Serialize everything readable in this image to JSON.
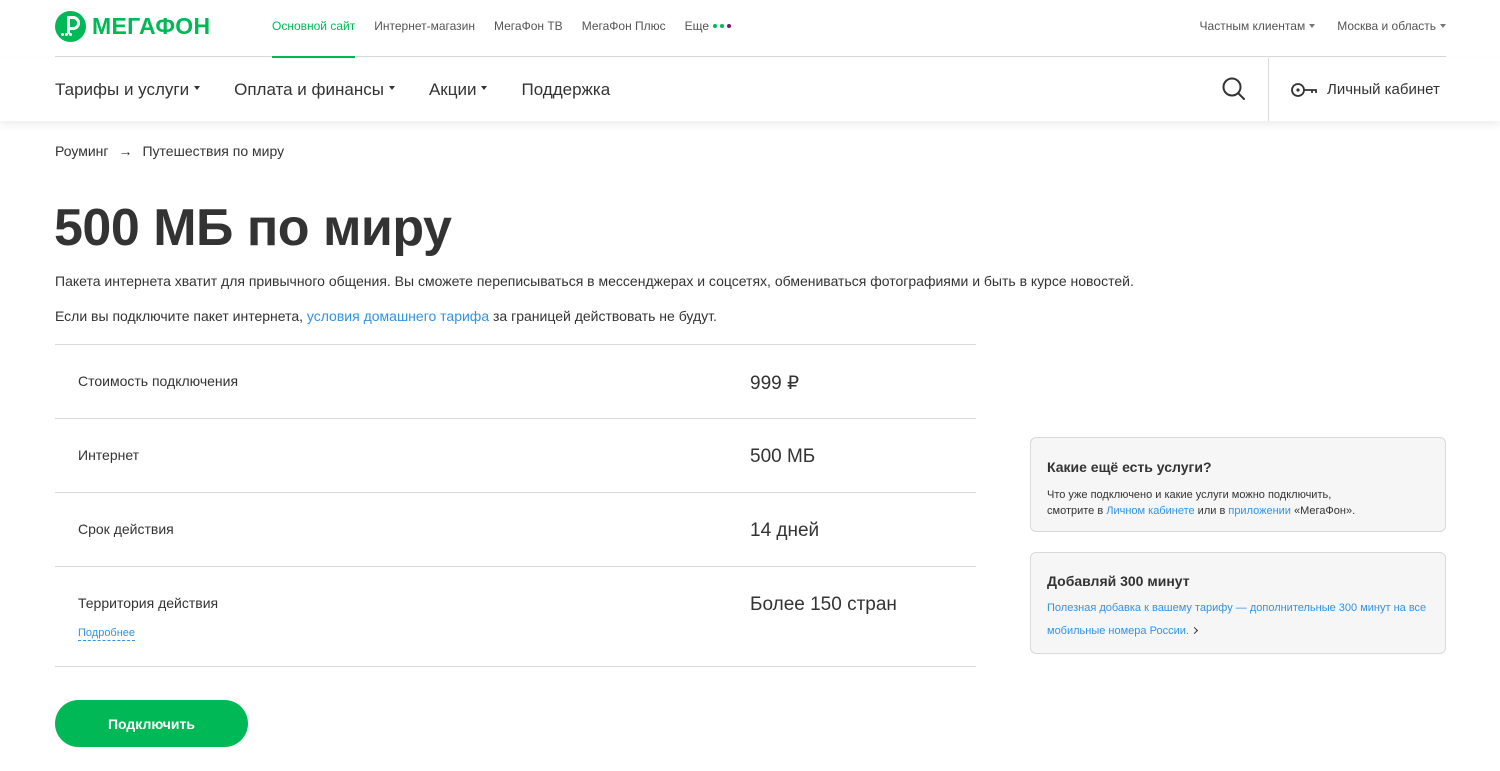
{
  "brand": {
    "name": "МегаФон",
    "logo_text": "МЕГАФОН",
    "accent_color": "#00b956",
    "link_color": "#3193e6"
  },
  "topnav": {
    "items": [
      {
        "label": "Основной сайт",
        "active": true
      },
      {
        "label": "Интернет-магазин",
        "active": false
      },
      {
        "label": "МегаФон ТВ",
        "active": false
      },
      {
        "label": "МегаФон Плюс",
        "active": false
      },
      {
        "label": "Еще",
        "active": false
      }
    ],
    "more_dots_colors": [
      "#00b956",
      "#731982",
      "#f62434"
    ],
    "client_type": "Частным клиентам",
    "region": "Москва и область"
  },
  "mainnav": {
    "items": [
      {
        "label": "Тарифы и услуги",
        "dropdown": true
      },
      {
        "label": "Оплата и финансы",
        "dropdown": true
      },
      {
        "label": "Акции",
        "dropdown": true
      },
      {
        "label": "Поддержка",
        "dropdown": false
      }
    ],
    "search_icon": "search-icon",
    "cabinet_icon": "key-icon",
    "cabinet_label": "Личный кабинет"
  },
  "breadcrumb": {
    "items": [
      "Роуминг",
      "Путешествия по миру"
    ],
    "separator": "→"
  },
  "page": {
    "title": "500 МБ по миру",
    "lead": "Пакета интернета хватит для привычного общения. Вы сможете переписываться в мессенджерах и соцсетях, обмениваться  фотографиями и быть в курсе новостей.",
    "note_before": "Если вы подключите пакет интернета, ",
    "note_link": "условия домашнего тарифа",
    "note_after": " за границей действовать не будут."
  },
  "params": [
    {
      "label": "Стоимость подключения",
      "value": "999 ₽"
    },
    {
      "label": "Интернет",
      "value": "500 МБ"
    },
    {
      "label": "Срок действия",
      "value": "14 дней"
    },
    {
      "label": "Территория действия",
      "value": "Более 150 стран",
      "more": "Подробнее"
    }
  ],
  "cards": [
    {
      "title": "Какие ещё есть услуги?",
      "text_1": "Что уже подключено и какие услуги можно подключить,",
      "text_2": "смотрите в ",
      "link_1": "Личном кабинете",
      "text_3": " или в ",
      "link_2": "приложении",
      "text_4": " «МегаФон»."
    },
    {
      "title": "Добавляй 300 минут",
      "text": "Полезная добавка к вашему тарифу — дополнительные 300 минут на все мобильные номера России."
    }
  ],
  "connect_button": "Подключить"
}
